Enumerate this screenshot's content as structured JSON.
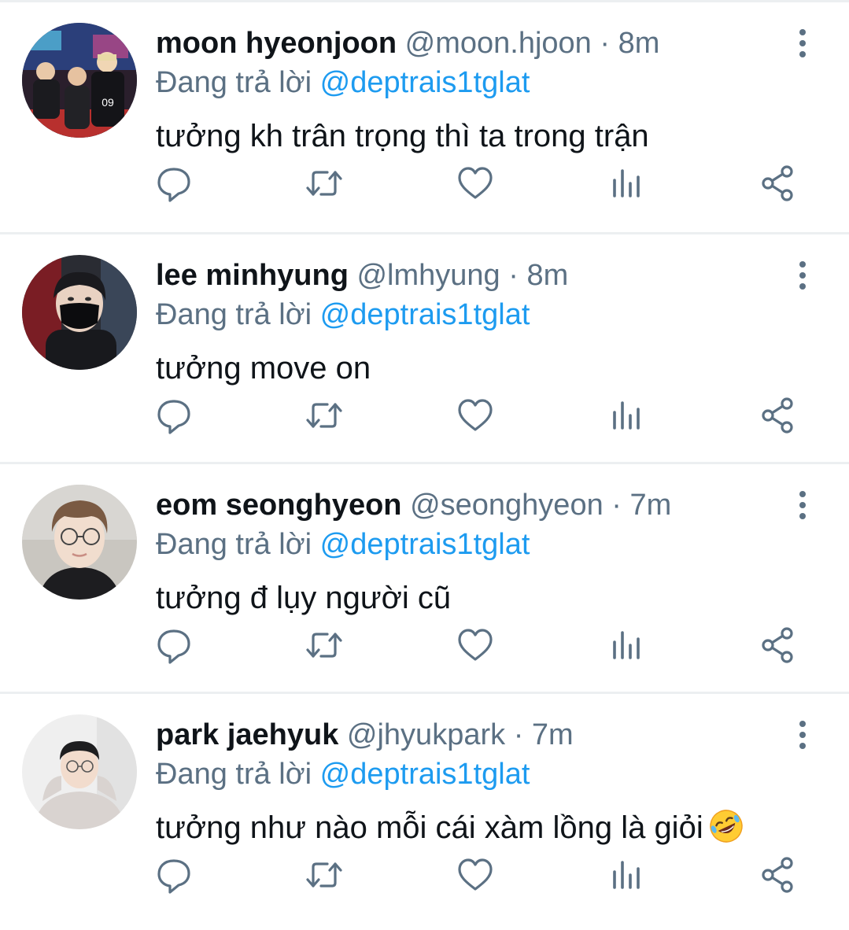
{
  "colors": {
    "name": "#0f1419",
    "secondary": "#5b7083",
    "mention": "#1d9bf0",
    "divider": "#eceff1",
    "icon": "#5b7083"
  },
  "icons": {
    "more": "more-vertical-icon",
    "reply": "reply-bubble-icon",
    "retweet": "retweet-icon",
    "like": "heart-icon",
    "views": "views-bar-chart-icon",
    "share": "share-icon"
  },
  "tweets": [
    {
      "name": "moon hyeonjoon",
      "handle": "@moon.hjoon",
      "dot": "·",
      "time": "8m",
      "replying_prefix": "Đang trả lời",
      "replying_to": "@deptrais1tglat",
      "text": "tưởng kh trân trọng thì ta trong trận"
    },
    {
      "name": "lee minhyung",
      "handle": "@lmhyung",
      "dot": "·",
      "time": "8m",
      "replying_prefix": "Đang trả lời",
      "replying_to": "@deptrais1tglat",
      "text": "tưởng move on"
    },
    {
      "name": "eom seonghyeon",
      "handle": "@seonghyeon",
      "dot": "·",
      "time": "7m",
      "replying_prefix": "Đang trả lời",
      "replying_to": "@deptrais1tglat",
      "text": "tưởng đ lụy người cũ"
    },
    {
      "name": "park jaehyuk",
      "handle": "@jhyukpark",
      "dot": "·",
      "time": "7m",
      "replying_prefix": "Đang trả lời",
      "replying_to": "@deptrais1tglat",
      "text": "tưởng như nào mỗi cái xàm lồng là giỏi",
      "emoji": "rolling-on-floor-laughing-emoji"
    }
  ]
}
